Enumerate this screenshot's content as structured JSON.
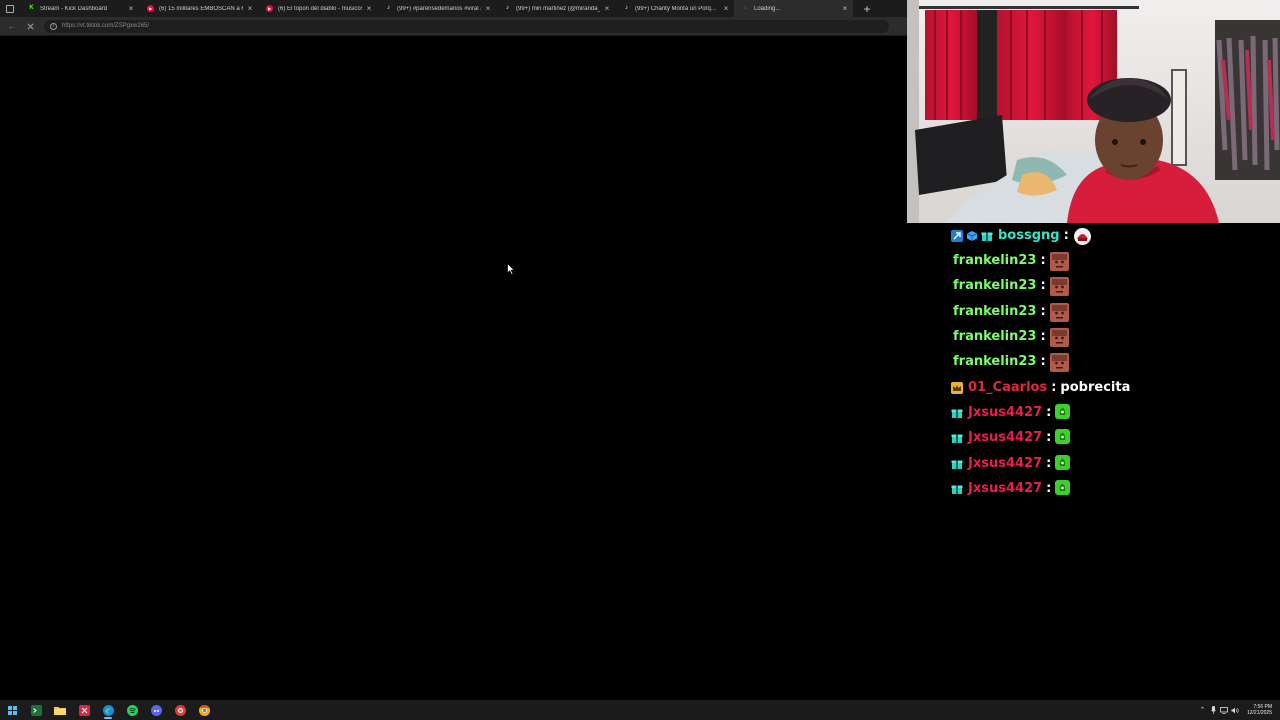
{
  "browser": {
    "tabs": [
      {
        "title": "Stream - Kick Dashboard",
        "favicon": "kick-icon",
        "color": "#53fc18",
        "active": false
      },
      {
        "title": "(6) 15 militares EMBOSCAN a 60 ...",
        "favicon": "youtube-icon",
        "color": "#ff0033",
        "active": false
      },
      {
        "title": "(6) El topon del diablo - musicos...",
        "favicon": "youtube-icon",
        "color": "#ff0033",
        "active": false
      },
      {
        "title": "(99+) #parensedemanos #viral #p...",
        "favicon": "tiktok-icon",
        "color": "#ffffff",
        "active": false
      },
      {
        "title": "(99+) miri martinez (@miranda_...",
        "favicon": "tiktok-icon",
        "color": "#ffffff",
        "active": false
      },
      {
        "title": "(99+) Charity Monta un Porq...",
        "favicon": "tiktok-icon",
        "color": "#ffffff",
        "active": false
      },
      {
        "title": "Loading...",
        "favicon": "loading-icon",
        "color": "#aaaaaa",
        "active": true
      }
    ],
    "new_tab_label": "+",
    "close_glyph": "×",
    "address": {
      "host": "https://vt.tiktok.com",
      "path": "/ZSPgxw265/"
    }
  },
  "chat": {
    "messages": [
      {
        "badges": [
          "booster",
          "cube",
          "gift"
        ],
        "user": "bossgng",
        "user_color": "#34e4c4",
        "text": "",
        "emote": "red-knight-emote"
      },
      {
        "badges": [],
        "user": "frankelin23",
        "user_color": "#7cfc6b",
        "text": "",
        "emote": "face-emote"
      },
      {
        "badges": [],
        "user": "frankelin23",
        "user_color": "#7cfc6b",
        "text": "",
        "emote": "face-emote"
      },
      {
        "badges": [],
        "user": "frankelin23",
        "user_color": "#7cfc6b",
        "text": "",
        "emote": "face-emote"
      },
      {
        "badges": [],
        "user": "frankelin23",
        "user_color": "#7cfc6b",
        "text": "",
        "emote": "face-emote"
      },
      {
        "badges": [],
        "user": "frankelin23",
        "user_color": "#7cfc6b",
        "text": "",
        "emote": "face-emote"
      },
      {
        "badges": [
          "crown"
        ],
        "user": "01_Caarlos",
        "user_color": "#e0283c",
        "text": "pobrecita",
        "emote": ""
      },
      {
        "badges": [
          "gift"
        ],
        "user": "Jxsus4427",
        "user_color": "#e81e4e",
        "text": "",
        "emote": "green-emote"
      },
      {
        "badges": [
          "gift"
        ],
        "user": "Jxsus4427",
        "user_color": "#e81e4e",
        "text": "",
        "emote": "green-emote"
      },
      {
        "badges": [
          "gift"
        ],
        "user": "Jxsus4427",
        "user_color": "#e81e4e",
        "text": "",
        "emote": "green-emote"
      },
      {
        "badges": [
          "gift"
        ],
        "user": "Jxsus4427",
        "user_color": "#e81e4e",
        "text": "",
        "emote": "green-emote"
      }
    ],
    "separator": ":"
  },
  "taskbar": {
    "apps": [
      "windows-start-icon",
      "terminal-icon",
      "file-explorer-icon",
      "capcut-icon",
      "edge-icon",
      "spotify-icon",
      "discord-icon",
      "media-app-icon",
      "chrome-icon"
    ],
    "time": "7:56 PM",
    "date": "12/21/2025"
  },
  "colors": {
    "tab_bg": "#1c1c1c",
    "toolbar_bg": "#2c2c2c",
    "taskbar_bg": "#1b1b1b"
  }
}
